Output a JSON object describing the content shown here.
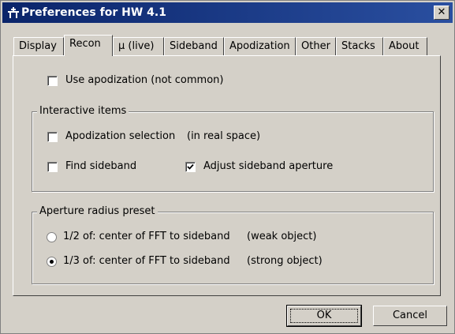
{
  "window": {
    "title": "Preferences for HW 4.1",
    "close_label": "✕"
  },
  "tabs": [
    {
      "label": "Display",
      "active": false
    },
    {
      "label": "Recon",
      "active": true
    },
    {
      "label": "µ (live)",
      "active": false
    },
    {
      "label": "Sideband",
      "active": false
    },
    {
      "label": "Apodization",
      "active": false
    },
    {
      "label": "Other",
      "active": false
    },
    {
      "label": "Stacks",
      "active": false
    },
    {
      "label": "About",
      "active": false
    }
  ],
  "recon": {
    "use_apodization": {
      "label": "Use apodization (not common)",
      "checked": false
    },
    "interactive_group": {
      "title": "Interactive items",
      "apodization_selection": {
        "label": "Apodization selection",
        "note": "(in real space)",
        "checked": false
      },
      "find_sideband": {
        "label": "Find sideband",
        "checked": false
      },
      "adjust_sideband_aperture": {
        "label": "Adjust sideband aperture",
        "checked": true
      }
    },
    "aperture_group": {
      "title": "Aperture radius preset",
      "options": [
        {
          "label": "1/2 of: center of FFT to sideband",
          "note": "(weak object)",
          "selected": false
        },
        {
          "label": "1/3 of: center of FFT to sideband",
          "note": "(strong object)",
          "selected": true
        }
      ]
    }
  },
  "buttons": {
    "ok": "OK",
    "cancel": "Cancel"
  }
}
